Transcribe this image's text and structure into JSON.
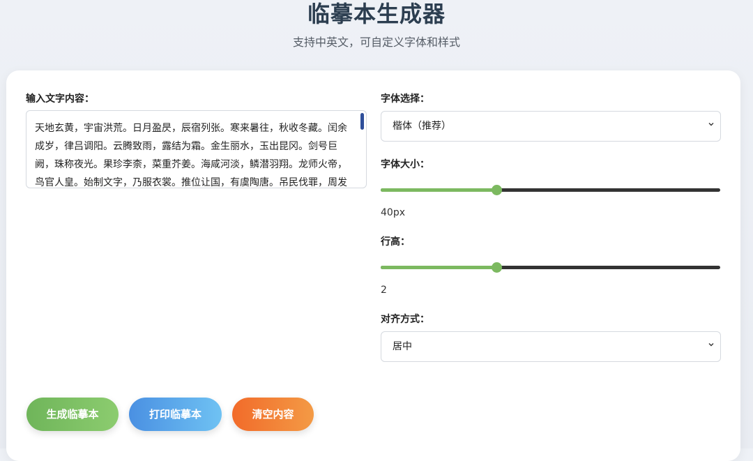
{
  "header": {
    "title": "临摹本生成器",
    "subtitle": "支持中英文，可自定义字体和样式"
  },
  "input": {
    "label": "输入文字内容：",
    "text": "天地玄黄，宇宙洪荒。日月盈昃，辰宿列张。寒来暑往，秋收冬藏。闰余成岁，律吕调阳。云腾致雨，露结为霜。金生丽水，玉出昆冈。剑号巨阙，珠称夜光。果珍李柰，菜重芥姜。海咸河淡，鳞潜羽翔。龙师火帝，鸟官人皇。始制文字，乃服衣裳。推位让国，有虞陶唐。吊民伐罪，周发殷汤。坐朝问道，垂拱平章。爱育黎首，臣伏戎羌。遐迩一"
  },
  "font": {
    "label": "字体选择：",
    "selected": "楷体（推荐）"
  },
  "font_size": {
    "label": "字体大小：",
    "value_text": "40px",
    "level": 0.34
  },
  "line_height": {
    "label": "行高：",
    "value_text": "2",
    "level": 0.34
  },
  "align": {
    "label": "对齐方式：",
    "selected": "居中"
  },
  "buttons": {
    "generate": "生成临摹本",
    "print": "打印临摹本",
    "clear": "清空内容"
  },
  "colors": {
    "accent_green": "#7cb960",
    "accent_blue": "#4a90e2",
    "accent_orange": "#f26b2a",
    "title": "#2c3e50"
  },
  "icons": {
    "select_chevron": "chevron-down-icon"
  }
}
